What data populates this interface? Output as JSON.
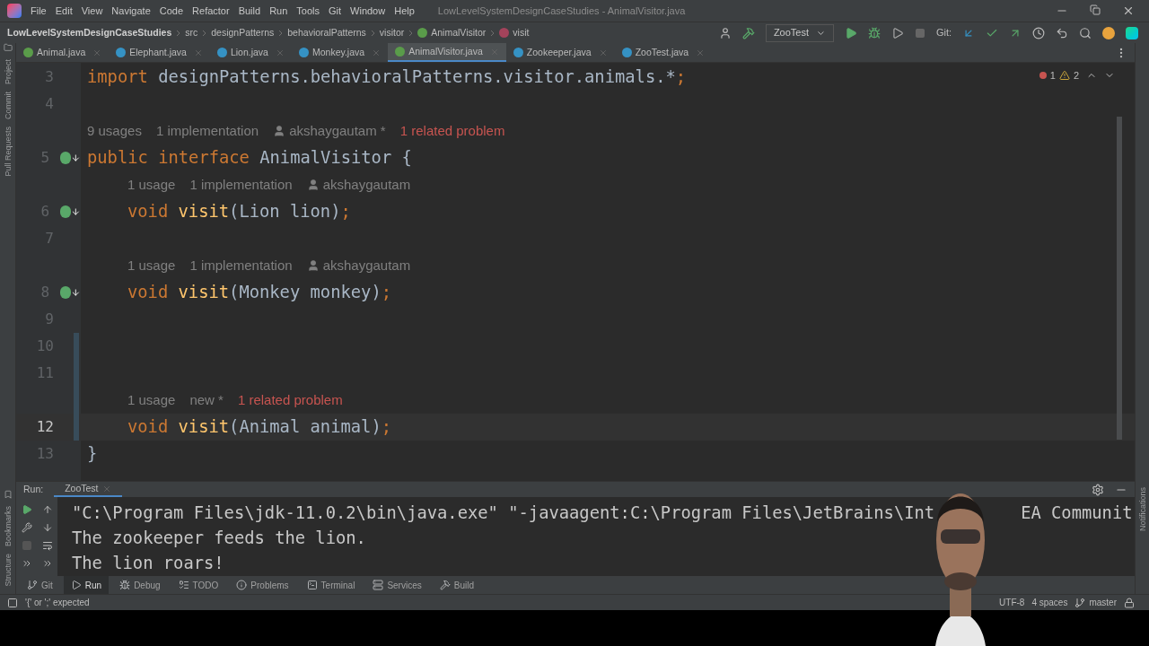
{
  "window": {
    "title": "LowLevelSystemDesignCaseStudies - AnimalVisitor.java"
  },
  "menu": [
    "File",
    "Edit",
    "View",
    "Navigate",
    "Code",
    "Refactor",
    "Build",
    "Run",
    "Tools",
    "Git",
    "Window",
    "Help"
  ],
  "breadcrumbs": [
    {
      "label": "LowLevelSystemDesignCaseStudies",
      "kind": "project"
    },
    {
      "label": "src",
      "kind": "folder"
    },
    {
      "label": "designPatterns",
      "kind": "folder"
    },
    {
      "label": "behavioralPatterns",
      "kind": "folder"
    },
    {
      "label": "visitor",
      "kind": "folder"
    },
    {
      "label": "AnimalVisitor",
      "kind": "interface"
    },
    {
      "label": "visit",
      "kind": "method"
    }
  ],
  "toolbar": {
    "run_config": "ZooTest",
    "git_label": "Git:"
  },
  "tabs": [
    {
      "label": "Animal.java",
      "kind": "interface",
      "selected": false
    },
    {
      "label": "Elephant.java",
      "kind": "class",
      "selected": false
    },
    {
      "label": "Lion.java",
      "kind": "class",
      "selected": false
    },
    {
      "label": "Monkey.java",
      "kind": "class",
      "selected": false
    },
    {
      "label": "AnimalVisitor.java",
      "kind": "interface",
      "selected": true
    },
    {
      "label": "Zookeeper.java",
      "kind": "class",
      "selected": false
    },
    {
      "label": "ZooTest.java",
      "kind": "runnable",
      "selected": false
    }
  ],
  "left_strip": [
    "Project",
    "Commit",
    "Pull Requests"
  ],
  "left_strip_bottom": [
    "Bookmarks",
    "Structure"
  ],
  "right_strip": [
    "Notifications"
  ],
  "inspections": {
    "errors": "1",
    "warnings": "2"
  },
  "editor": [
    {
      "kind": "code",
      "number": "3",
      "indented": false,
      "marker": false,
      "current": false,
      "changed": false,
      "tokens": [
        {
          "kind": "keyword",
          "text": "import"
        },
        {
          "kind": "plain",
          "text": " designPatterns.behavioralPatterns.visitor.animals.*"
        },
        {
          "kind": "keyword",
          "text": ";"
        }
      ]
    },
    {
      "kind": "code",
      "number": "4",
      "marker": false,
      "current": false,
      "changed": false
    },
    {
      "kind": "hints",
      "indented": false,
      "items": [
        {
          "kind": "plain",
          "text": "9 usages"
        },
        {
          "kind": "plain",
          "text": "1 implementation"
        },
        {
          "kind": "author",
          "text": "akshaygautam *"
        },
        {
          "kind": "problem",
          "text": "1 related problem"
        }
      ]
    },
    {
      "kind": "code",
      "number": "5",
      "indented": false,
      "marker": true,
      "current": false,
      "changed": false,
      "tokens": [
        {
          "kind": "keyword",
          "text": "public interface"
        },
        {
          "kind": "plain",
          "text": " AnimalVisitor {"
        }
      ]
    },
    {
      "kind": "hints",
      "indented": true,
      "items": [
        {
          "kind": "plain",
          "text": "1 usage"
        },
        {
          "kind": "plain",
          "text": "1 implementation"
        },
        {
          "kind": "author",
          "text": "akshaygautam"
        }
      ]
    },
    {
      "kind": "code",
      "number": "6",
      "indented": true,
      "marker": true,
      "current": false,
      "changed": false,
      "tokens": [
        {
          "kind": "keyword",
          "text": "void"
        },
        {
          "kind": "method",
          "text": "visit"
        },
        {
          "kind": "plain",
          "text": "(Lion lion)"
        },
        {
          "kind": "keyword",
          "text": ";"
        }
      ]
    },
    {
      "kind": "code",
      "number": "7",
      "marker": false,
      "current": false,
      "changed": false
    },
    {
      "kind": "hints",
      "indented": true,
      "items": [
        {
          "kind": "plain",
          "text": "1 usage"
        },
        {
          "kind": "plain",
          "text": "1 implementation"
        },
        {
          "kind": "author",
          "text": "akshaygautam"
        }
      ]
    },
    {
      "kind": "code",
      "number": "8",
      "indented": true,
      "marker": true,
      "current": false,
      "changed": false,
      "tokens": [
        {
          "kind": "keyword",
          "text": "void"
        },
        {
          "kind": "method",
          "text": "visit"
        },
        {
          "kind": "plain",
          "text": "(Monkey monkey)"
        },
        {
          "kind": "keyword",
          "text": ";"
        }
      ]
    },
    {
      "kind": "code",
      "number": "9",
      "marker": false,
      "current": false,
      "changed": false
    },
    {
      "kind": "code",
      "number": "10",
      "marker": false,
      "current": false,
      "changed": true
    },
    {
      "kind": "code",
      "number": "11",
      "marker": false,
      "current": false,
      "changed": true
    },
    {
      "kind": "hints",
      "indented": true,
      "changed": true,
      "items": [
        {
          "kind": "plain",
          "text": "1 usage"
        },
        {
          "kind": "plain",
          "text": "new *"
        },
        {
          "kind": "problem",
          "text": "1 related problem"
        }
      ]
    },
    {
      "kind": "code",
      "number": "12",
      "indented": true,
      "marker": false,
      "current": true,
      "changed": true,
      "tokens": [
        {
          "kind": "keyword",
          "text": "void"
        },
        {
          "kind": "method",
          "text": "visit"
        },
        {
          "kind": "plain",
          "text": "(Animal animal)"
        },
        {
          "kind": "keyword",
          "text": ";"
        }
      ]
    },
    {
      "kind": "code",
      "number": "13",
      "indented": false,
      "marker": false,
      "current": false,
      "changed": false,
      "tokens": [
        {
          "kind": "plain",
          "text": "}"
        }
      ]
    }
  ],
  "run_panel": {
    "label": "Run:",
    "tab": "ZooTest",
    "console": [
      {
        "parts": [
          "\"C:\\Program Files\\jdk-11.0.2\\bin\\java.exe\" \"-javaagent:C:\\Program Files\\JetBrains\\Int",
          "EA Communit"
        ]
      },
      {
        "parts": [
          "The zookeeper feeds the lion."
        ]
      },
      {
        "parts": [
          "The lion roars!"
        ]
      }
    ]
  },
  "tool_tabs": [
    {
      "label": "Git",
      "kind": "git",
      "selected": false
    },
    {
      "label": "Run",
      "kind": "run",
      "selected": true
    },
    {
      "label": "Debug",
      "kind": "debug",
      "selected": false
    },
    {
      "label": "TODO",
      "kind": "todo",
      "selected": false
    },
    {
      "label": "Problems",
      "kind": "problems",
      "selected": false
    },
    {
      "label": "Terminal",
      "kind": "terminal",
      "selected": false
    },
    {
      "label": "Services",
      "kind": "services",
      "selected": false
    },
    {
      "label": "Build",
      "kind": "build",
      "selected": false
    }
  ],
  "status_bar": {
    "message": "'{' or ';' expected",
    "encoding": "UTF-8",
    "indent": "4 spaces",
    "branch": "master"
  }
}
